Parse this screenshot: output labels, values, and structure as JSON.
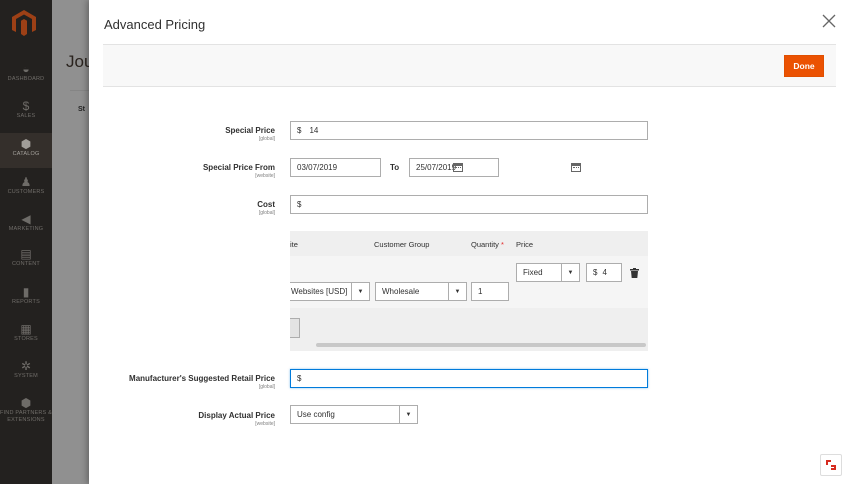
{
  "sidebar": {
    "items": [
      {
        "label": "DASHBOARD",
        "icon": "dashboard-icon",
        "glyph": "◒"
      },
      {
        "label": "SALES",
        "icon": "dollar-icon",
        "glyph": "$"
      },
      {
        "label": "CATALOG",
        "icon": "cube-icon",
        "glyph": "⬢"
      },
      {
        "label": "CUSTOMERS",
        "icon": "person-icon",
        "glyph": "♟"
      },
      {
        "label": "MARKETING",
        "icon": "megaphone-icon",
        "glyph": "◀"
      },
      {
        "label": "CONTENT",
        "icon": "layout-icon",
        "glyph": "▤"
      },
      {
        "label": "REPORTS",
        "icon": "bar-chart-icon",
        "glyph": "▮"
      },
      {
        "label": "STORES",
        "icon": "store-icon",
        "glyph": "▦"
      },
      {
        "label": "SYSTEM",
        "icon": "gear-icon",
        "glyph": "✲"
      },
      {
        "label": "FIND PARTNERS & EXTENSIONS",
        "icon": "partners-icon",
        "glyph": "⬢"
      }
    ],
    "active": "CATALOG"
  },
  "background_page": {
    "title": "Jou",
    "tab": "St"
  },
  "modal": {
    "title": "Advanced Pricing",
    "done_label": "Done",
    "special_price": {
      "label": "Special Price",
      "scope": "[global]",
      "currency": "$",
      "value": "14"
    },
    "special_price_from": {
      "label": "Special Price From",
      "scope": "[website]",
      "from_value": "03/07/2019",
      "to_label": "To",
      "to_value": "25/07/2019"
    },
    "cost": {
      "label": "Cost",
      "scope": "[global]",
      "currency": "$",
      "value": ""
    },
    "tier_grid": {
      "headers": {
        "website": "ite",
        "customer_group": "Customer Group",
        "quantity": "Quantity",
        "required_mark": "*",
        "price": "Price"
      },
      "row": {
        "website": "Websites [USD]",
        "customer_group": "Wholesale",
        "quantity": "1",
        "price_type": "Fixed",
        "price_currency": "$",
        "price_value": "4"
      }
    },
    "msrp": {
      "label": "Manufacturer's Suggested Retail Price",
      "scope": "[global]",
      "currency": "$",
      "value": ""
    },
    "display_actual_price": {
      "label": "Display Actual Price",
      "scope": "[website]",
      "value": "Use config"
    }
  },
  "colors": {
    "accent": "#eb5202",
    "sidebar_bg": "#373330",
    "focus_border": "#007bdb"
  }
}
